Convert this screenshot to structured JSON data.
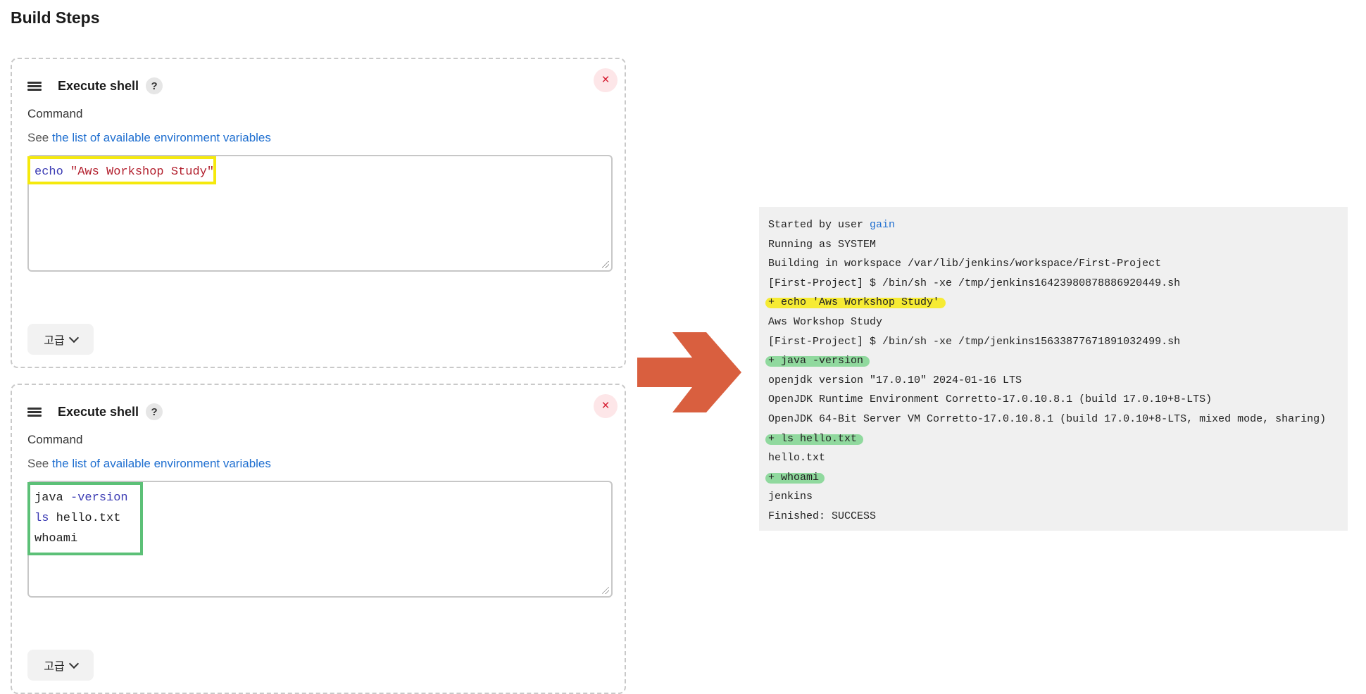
{
  "page_title": "Build Steps",
  "steps": [
    {
      "title": "Execute shell",
      "help": "?",
      "close": "×",
      "command_label": "Command",
      "hint_prefix": "See ",
      "hint_link": "the list of available environment variables",
      "lines": [
        {
          "parts": [
            {
              "t": "echo",
              "c": "kw"
            },
            {
              "t": " ",
              "c": ""
            },
            {
              "t": "\"Aws Workshop Study\"",
              "c": "str"
            }
          ]
        }
      ],
      "advanced_label": "고급"
    },
    {
      "title": "Execute shell",
      "help": "?",
      "close": "×",
      "command_label": "Command",
      "hint_prefix": "See ",
      "hint_link": "the list of available environment variables",
      "lines": [
        {
          "parts": [
            {
              "t": "java ",
              "c": ""
            },
            {
              "t": "-version",
              "c": "kw"
            }
          ]
        },
        {
          "parts": [
            {
              "t": "ls",
              "c": "kw"
            },
            {
              "t": " hello.txt",
              "c": ""
            }
          ]
        },
        {
          "parts": [
            {
              "t": "whoami",
              "c": ""
            }
          ]
        }
      ],
      "advanced_label": "고급"
    }
  ],
  "arrow_color": "#d95f3f",
  "console": {
    "started_by_prefix": "Started by user ",
    "started_by_user": "gain",
    "lines": [
      {
        "text": "Running as SYSTEM",
        "highlight": ""
      },
      {
        "text": "Building in workspace /var/lib/jenkins/workspace/First-Project",
        "highlight": ""
      },
      {
        "text": "[First-Project] $ /bin/sh -xe /tmp/jenkins16423980878886920449.sh",
        "highlight": ""
      },
      {
        "text": "+ echo 'Aws Workshop Study'",
        "highlight": "yellow"
      },
      {
        "text": "Aws Workshop Study",
        "highlight": ""
      },
      {
        "text": "[First-Project] $ /bin/sh -xe /tmp/jenkins15633877671891032499.sh",
        "highlight": ""
      },
      {
        "text": "+ java -version",
        "highlight": "green"
      },
      {
        "text": "openjdk version \"17.0.10\" 2024-01-16 LTS",
        "highlight": ""
      },
      {
        "text": "OpenJDK Runtime Environment Corretto-17.0.10.8.1 (build 17.0.10+8-LTS)",
        "highlight": ""
      },
      {
        "text": "OpenJDK 64-Bit Server VM Corretto-17.0.10.8.1 (build 17.0.10+8-LTS, mixed mode, sharing)",
        "highlight": ""
      },
      {
        "text": "+ ls hello.txt",
        "highlight": "green"
      },
      {
        "text": "hello.txt",
        "highlight": ""
      },
      {
        "text": "+ whoami",
        "highlight": "green"
      },
      {
        "text": "jenkins",
        "highlight": ""
      },
      {
        "text": "Finished: SUCCESS",
        "highlight": ""
      }
    ]
  }
}
